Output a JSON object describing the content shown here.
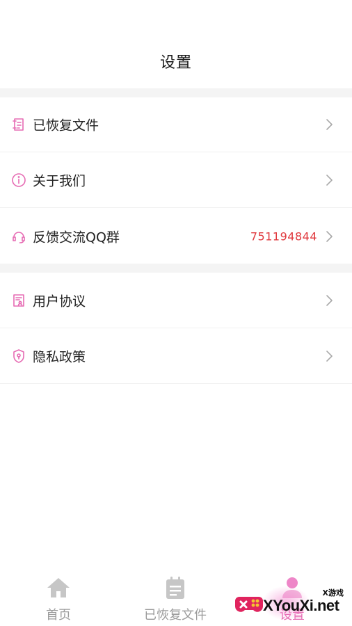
{
  "header": {
    "title": "设置"
  },
  "groups": [
    {
      "items": [
        {
          "label": "已恢复文件",
          "icon": "document-list-icon"
        },
        {
          "label": "关于我们",
          "icon": "info-circle-icon"
        },
        {
          "label": "反馈交流QQ群",
          "icon": "headset-icon",
          "value": "751194844"
        }
      ]
    },
    {
      "items": [
        {
          "label": "用户协议",
          "icon": "user-agreement-icon"
        },
        {
          "label": "隐私政策",
          "icon": "privacy-shield-icon"
        }
      ]
    }
  ],
  "tabbar": {
    "items": [
      {
        "label": "首页",
        "icon": "home-icon"
      },
      {
        "label": "已恢复文件",
        "icon": "calendar-file-icon"
      },
      {
        "label": "设置",
        "icon": "user-icon"
      }
    ]
  },
  "watermark": {
    "main": "XYouXi.net",
    "small": "X游戏"
  },
  "colors": {
    "accent": "#e66bb3",
    "value_red": "#e0393e",
    "tab_gray": "#9b9b9b",
    "section_gap": "#f4f4f4"
  }
}
